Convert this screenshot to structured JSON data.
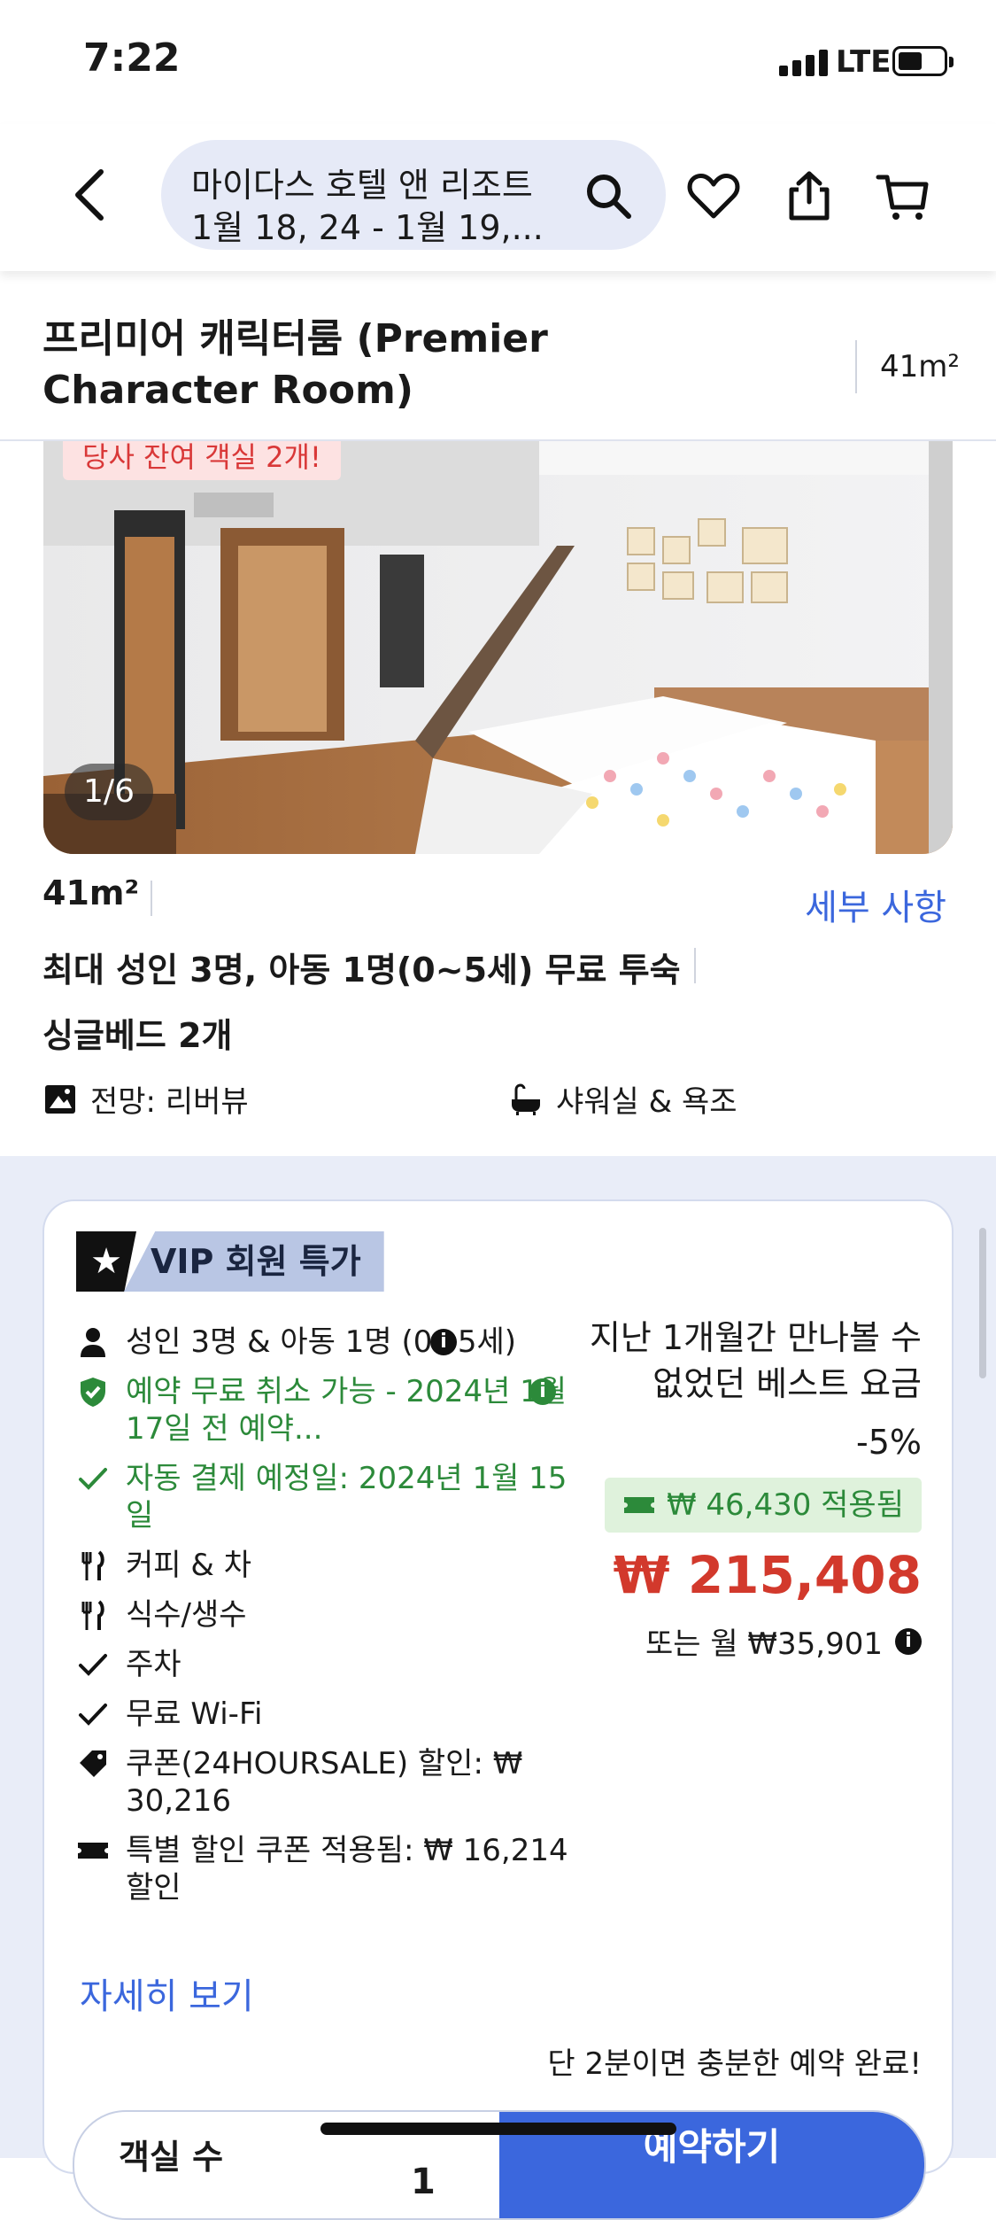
{
  "status_bar": {
    "time": "7:22",
    "network": "LTE"
  },
  "nav": {
    "hotel_name": "마이다스 호텔 앤 리조트",
    "dates": "1월 18, 24 - 1월 19,..."
  },
  "room": {
    "title": "프리미어 캐릭터룸 (Premier Character Room)",
    "size": "41m²",
    "photo_badge": "당사 잔여 객실 2개!",
    "photo_counter": "1/6",
    "details_link": "세부 사항",
    "occupancy": "최대 성인 3명, 아동 1명(0~5세) 무료 투숙",
    "beds": "싱글베드 2개",
    "feature_view": "전망: 리버뷰",
    "feature_bath": "샤워실 & 욕조"
  },
  "offer": {
    "vip_label": "VIP 회원 특가",
    "items": [
      "성인 3명 & 아동 1명 (0~5세)",
      "예약 무료 취소 가능 - 2024년 1월 17일 전 예약...",
      "자동 결제 예정일: 2024년 1월 15일",
      "커피 & 차",
      "식수/생수",
      "주차",
      "무료 Wi-Fi",
      "쿠폰(24HOURSALE) 할인: ₩ 30,216",
      "특별 할인 쿠폰 적용됨: ₩ 16,214 할인"
    ],
    "more_link": "자세히 보기",
    "best_rate_note": "지난 1개월간 만나볼 수 없었던 베스트 요금",
    "discount_pct": "-5%",
    "coupon_applied": "₩ 46,430 적용됨",
    "price": "₩ 215,408",
    "monthly": "또는 월 ₩35,901",
    "finish_note": "단 2분이면 충분한 예약 완료!",
    "rooms_label": "객실 수",
    "rooms_count": "1",
    "book_button": "예약하기"
  }
}
